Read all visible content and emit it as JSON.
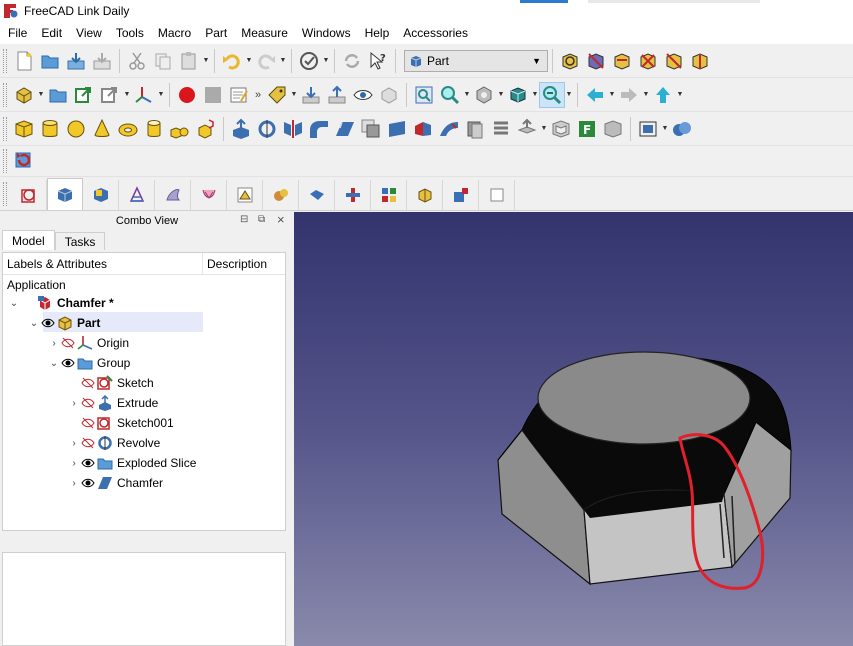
{
  "window": {
    "title": "FreeCAD Link Daily"
  },
  "menu": [
    "File",
    "Edit",
    "View",
    "Tools",
    "Macro",
    "Part",
    "Measure",
    "Windows",
    "Help",
    "Accessories"
  ],
  "workbench_selector": {
    "value": "Part"
  },
  "combo_view": {
    "title": "Combo View",
    "tabs": [
      "Model",
      "Tasks"
    ],
    "columns": [
      "Labels & Attributes",
      "Description"
    ],
    "root_label": "Application",
    "items": [
      {
        "label": "Chamfer *"
      },
      {
        "label": "Part"
      },
      {
        "label": "Origin"
      },
      {
        "label": "Group"
      },
      {
        "label": "Sketch"
      },
      {
        "label": "Extrude"
      },
      {
        "label": "Sketch001"
      },
      {
        "label": "Revolve"
      },
      {
        "label": "Exploded Slice"
      },
      {
        "label": "Chamfer"
      }
    ]
  },
  "colors": {
    "accent": "#2b79d0",
    "selection": "#e5e9f9",
    "annotation": "#e0202a",
    "viewport_top": "#33336e",
    "viewport_bottom": "#8a8aac"
  }
}
